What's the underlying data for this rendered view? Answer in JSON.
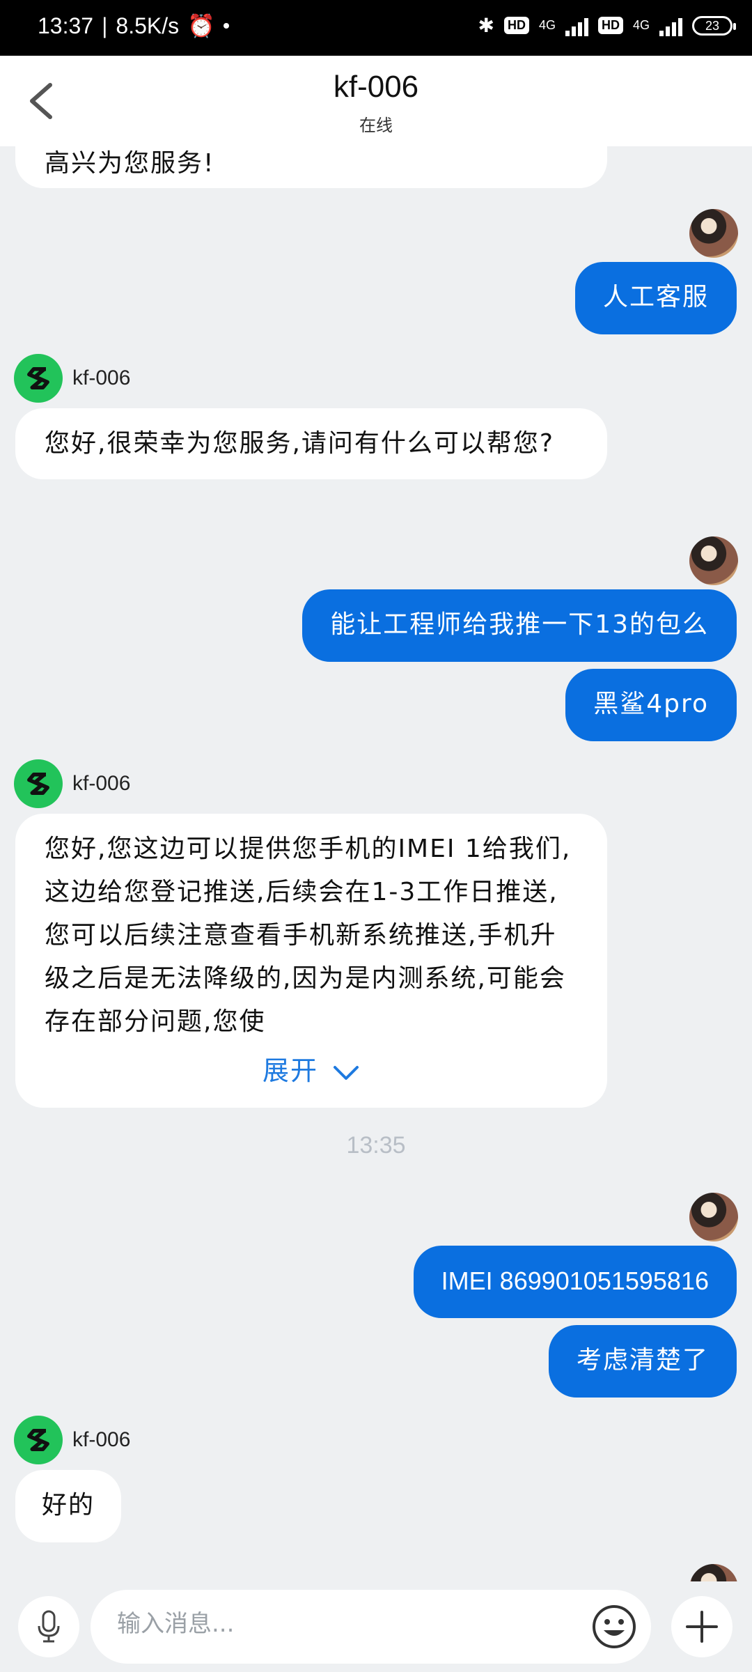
{
  "status": {
    "time": "13:37",
    "speed": "8.5K/s",
    "hd1": "HD",
    "net1": "4G",
    "hd2": "HD",
    "net2": "4G",
    "battery": "23"
  },
  "header": {
    "title": "kf-006",
    "subtitle": "在线"
  },
  "messages": {
    "m0": "高兴为您服务!",
    "m1": "人工客服",
    "agent_name": "kf-006",
    "m2": "您好,很荣幸为您服务,请问有什么可以帮您?",
    "m3": "能让工程师给我推一下13的包么",
    "m4": "黑鲨4pro",
    "m5": "您好,您这边可以提供您手机的IMEI 1给我们,这边给您登记推送,后续会在1-3工作日推送,您可以后续注意查看手机新系统推送,手机升级之后是无法降级的,因为是内测系统,可能会存在部分问题,您使",
    "expand": "展开",
    "time": "13:35",
    "m6": "IMEI 869901051595816",
    "m7": "考虑清楚了",
    "m8": "好的"
  },
  "input": {
    "placeholder": "输入消息..."
  }
}
